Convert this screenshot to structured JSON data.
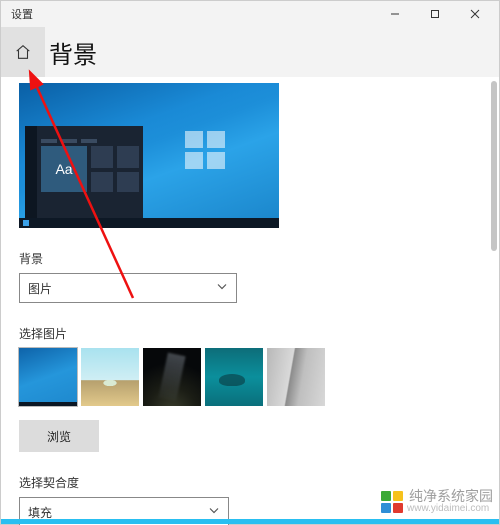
{
  "window": {
    "title": "设置"
  },
  "page": {
    "title": "背景"
  },
  "preview": {
    "sample_tile_text": "Aa"
  },
  "background": {
    "label": "背景",
    "selected": "图片"
  },
  "choose_picture": {
    "label": "选择图片",
    "browse_label": "浏览"
  },
  "fit": {
    "label": "选择契合度",
    "selected": "填充"
  },
  "watermark": {
    "text": "纯净系统家园",
    "url": "www.yidaimei.com"
  }
}
